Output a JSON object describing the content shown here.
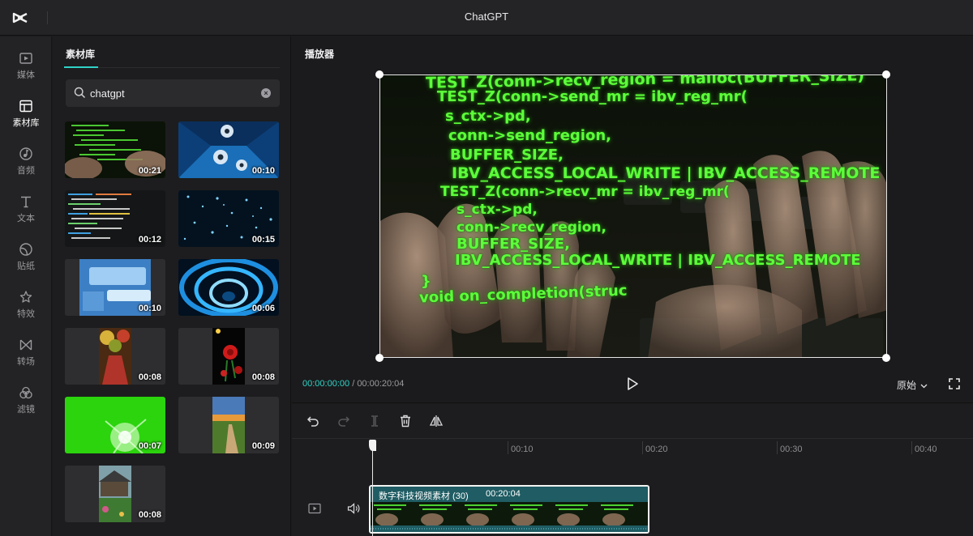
{
  "app": {
    "title": "ChatGPT",
    "logo": "capcut-logo-icon"
  },
  "rail": {
    "items": [
      {
        "label": "媒体",
        "icon": "media-icon"
      },
      {
        "label": "素材库",
        "icon": "library-icon",
        "active": true
      },
      {
        "label": "音频",
        "icon": "audio-icon"
      },
      {
        "label": "文本",
        "icon": "text-icon"
      },
      {
        "label": "贴纸",
        "icon": "sticker-icon"
      },
      {
        "label": "特效",
        "icon": "effects-icon"
      },
      {
        "label": "转场",
        "icon": "transition-icon"
      },
      {
        "label": "滤镜",
        "icon": "filter-icon"
      }
    ]
  },
  "library": {
    "tab_label": "素材库",
    "search": {
      "value": "chatgpt",
      "icon": "search-icon",
      "clear_icon": "clear-icon"
    },
    "thumbnails": [
      {
        "duration": "00:21",
        "theme": "code-typing"
      },
      {
        "duration": "00:10",
        "theme": "blue-3d-spheres"
      },
      {
        "duration": "00:12",
        "theme": "code-screen"
      },
      {
        "duration": "00:15",
        "theme": "digital-stars"
      },
      {
        "duration": "00:10",
        "theme": "browser-address-bar"
      },
      {
        "duration": "00:06",
        "theme": "blue-tunnel"
      },
      {
        "duration": "00:08",
        "theme": "flower-arch"
      },
      {
        "duration": "00:08",
        "theme": "red-rose"
      },
      {
        "duration": "00:07",
        "theme": "green-screen-burst"
      },
      {
        "duration": "00:09",
        "theme": "sunset-path"
      },
      {
        "duration": "00:08",
        "theme": "cabin-garden"
      }
    ]
  },
  "player": {
    "title": "播放器",
    "current_time": "00:00:00:00",
    "separator": "/",
    "total_time": "00:00:20:04",
    "ratio_label": "原始",
    "video_lines": [
      "TEST_Z(conn->recv_region = malloc(BUFFER_SIZE)",
      "TEST_Z(conn->send_mr = ibv_reg_mr(",
      "s_ctx->pd,",
      "conn->send_region,",
      "BUFFER_SIZE,",
      "IBV_ACCESS_LOCAL_WRITE | IBV_ACCESS_REMOTE",
      "TEST_Z(conn->recv_mr = ibv_reg_mr(",
      "s_ctx->pd,",
      "conn->recv_region,",
      "BUFFER_SIZE,",
      "IBV_ACCESS_LOCAL_WRITE | IBV_ACCESS_REMOTE",
      "}",
      "void on_completion(struc"
    ]
  },
  "timeline": {
    "tools": [
      "undo-icon",
      "redo-icon",
      "split-icon",
      "delete-icon",
      "mirror-icon"
    ],
    "ruler_labels": [
      "00:10",
      "00:20",
      "00:30",
      "00:40"
    ],
    "clip": {
      "name": "数字科技视频素材 (30)",
      "duration": "00:20:04"
    }
  },
  "colors": {
    "accent": "#2ed3c6",
    "clip": "#1f5c63",
    "code_green": "#5cff3a"
  }
}
